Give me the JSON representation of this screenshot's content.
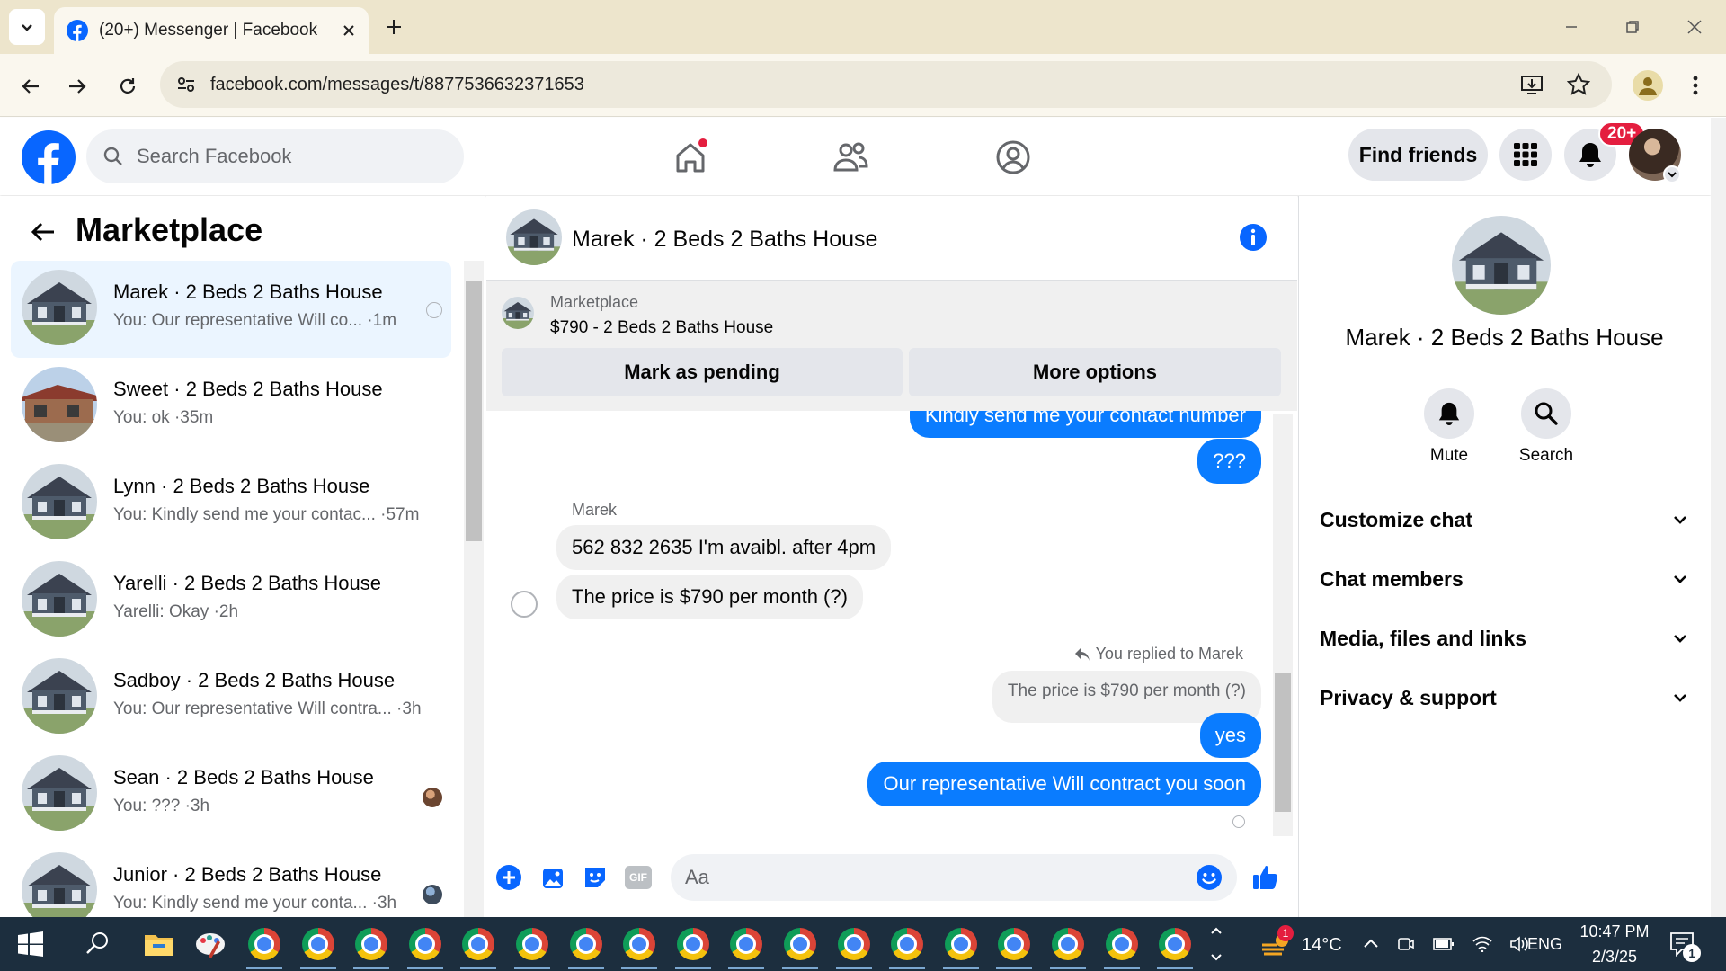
{
  "browser": {
    "tab_title": "(20+) Messenger | Facebook",
    "url": "facebook.com/messages/t/8877536632371653"
  },
  "fb": {
    "search_placeholder": "Search Facebook",
    "find_friends": "Find friends",
    "notification_badge": "20+",
    "brand_color": "#0866ff"
  },
  "left": {
    "title": "Marketplace",
    "conversations": [
      {
        "name": "Marek · 2 Beds 2 Baths House",
        "preview": "You: Our representative Will co... ·1m",
        "active": true
      },
      {
        "name": "Sweet · 2 Beds 2 Baths House",
        "preview": "You: ok ·35m"
      },
      {
        "name": "Lynn · 2 Beds 2 Baths House",
        "preview": "You: Kindly send me your contac... ·57m"
      },
      {
        "name": "Yarelli · 2 Beds 2 Baths House",
        "preview": "Yarelli: Okay ·2h"
      },
      {
        "name": "Sadboy · 2 Beds 2 Baths House",
        "preview": "You: Our representative Will contra... ·3h"
      },
      {
        "name": "Sean · 2 Beds 2 Baths House",
        "preview": "You: ??? ·3h"
      },
      {
        "name": "Junior · 2 Beds 2 Baths House",
        "preview": "You: Kindly send me your conta... ·3h"
      }
    ]
  },
  "chat": {
    "title": "Marek · 2 Beds 2 Baths House",
    "marketplace_label": "Marketplace",
    "listing": "$790 - 2 Beds 2 Baths House",
    "mark_pending": "Mark as pending",
    "more_options": "More options",
    "messages": {
      "m1": "Kindly send me your contact number",
      "m2": "???",
      "sender": "Marek",
      "m3": "562 832 2635 I'm avaibl. after 4pm",
      "m4": "The price is $790 per month (?)",
      "replied_to": "You replied to Marek",
      "quote": "The price is $790 per month (?)",
      "m5": "yes",
      "m6": "Our representative Will contract you soon"
    },
    "composer_placeholder": "Aa",
    "gif_label": "GIF"
  },
  "right": {
    "name": "Marek · 2 Beds 2 Baths House",
    "mute": "Mute",
    "search": "Search",
    "sections": [
      "Customize chat",
      "Chat members",
      "Media, files and links",
      "Privacy & support"
    ]
  },
  "taskbar": {
    "temperature": "14°C",
    "language": "ENG",
    "time": "10:47 PM",
    "date": "2/3/25",
    "notif_count": "1",
    "weather_badge": "1"
  }
}
